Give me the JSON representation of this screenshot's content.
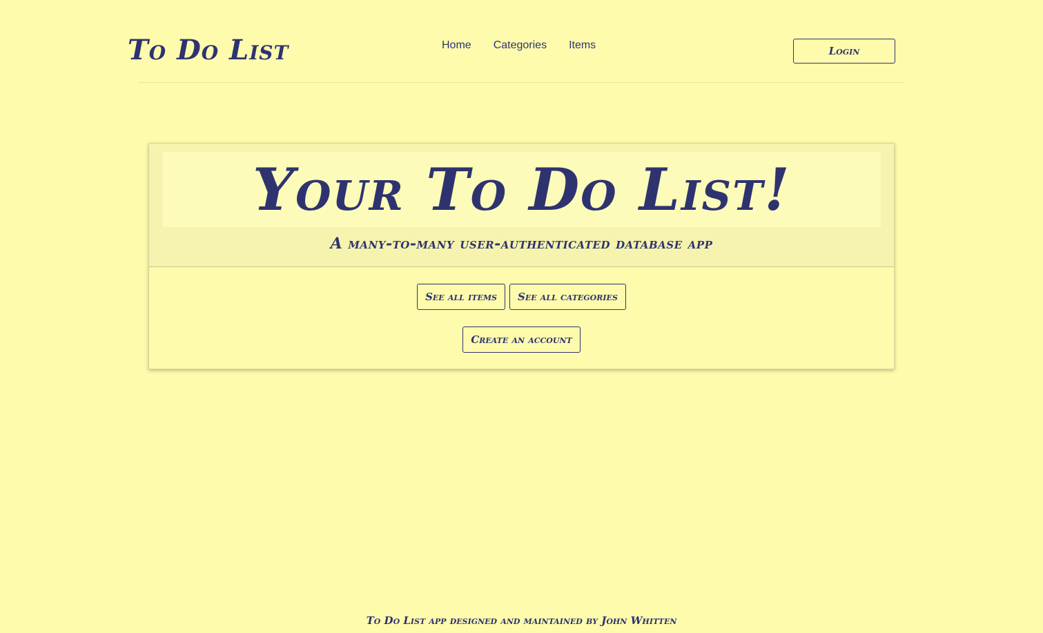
{
  "header": {
    "brand": "To Do List",
    "nav": [
      {
        "label": "Home"
      },
      {
        "label": "Categories"
      },
      {
        "label": "Items"
      }
    ],
    "login_label": "Login"
  },
  "hero": {
    "title": "Your To Do List!",
    "subtitle": "A many-to-many user-authenticated database app"
  },
  "actions": {
    "see_items_label": "See all items",
    "see_categories_label": "See all categories",
    "create_account_label": "Create an account"
  },
  "footer": {
    "text": "To Do List app designed and maintained by John Whitten"
  },
  "colors": {
    "background": "#fffbad",
    "text": "#2e3370",
    "card_header": "#f5f3ad"
  }
}
